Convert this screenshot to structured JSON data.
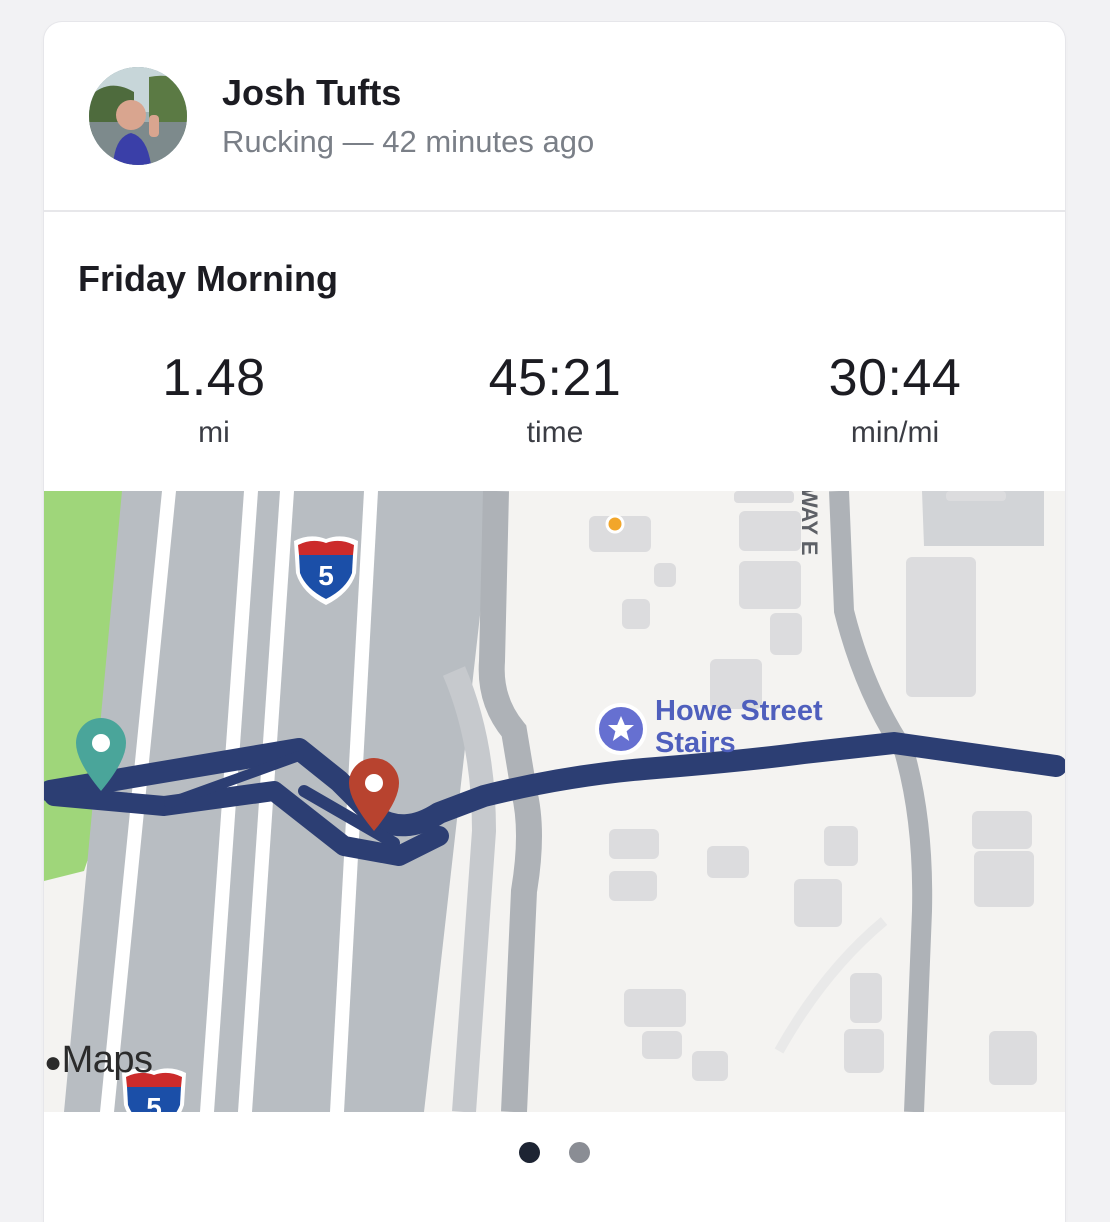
{
  "user": {
    "name": "Josh Tufts",
    "subtitle": "Rucking — 42 minutes ago"
  },
  "activity": {
    "title": "Friday Morning",
    "stats": [
      {
        "value": "1.48",
        "unit": "mi"
      },
      {
        "value": "45:21",
        "unit": "time"
      },
      {
        "value": "30:44",
        "unit": "min/mi"
      }
    ]
  },
  "map": {
    "poi_label_line1": "Howe Street",
    "poi_label_line2": "Stairs",
    "highway_shield_number": "5",
    "street_label": "WAY E",
    "attribution": "Maps",
    "route_color": "#2c3e73",
    "start_pin_color": "#4aa59a",
    "end_pin_color": "#b8432f"
  },
  "pagination": {
    "total": 2,
    "active_index": 0
  }
}
